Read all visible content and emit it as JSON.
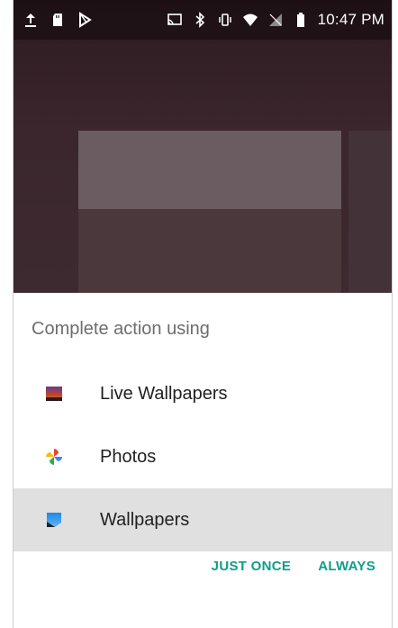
{
  "status_bar": {
    "time": "10:47 PM",
    "left_icons": [
      "upload-icon",
      "sd-card-icon",
      "play-store-icon"
    ],
    "right_icons": [
      "cast-icon",
      "bluetooth-icon",
      "vibrate-icon",
      "wifi-icon",
      "no-sim-icon",
      "battery-icon"
    ]
  },
  "dialog": {
    "title": "Complete action using",
    "options": [
      {
        "label": "Live Wallpapers",
        "icon": "live-wallpapers-icon",
        "selected": false
      },
      {
        "label": "Photos",
        "icon": "photos-icon",
        "selected": false
      },
      {
        "label": "Wallpapers",
        "icon": "wallpapers-icon",
        "selected": true
      }
    ],
    "buttons": {
      "just_once": "JUST ONCE",
      "always": "ALWAYS"
    }
  },
  "colors": {
    "accent": "#0f9d8a",
    "wallpaper": "#3a262c",
    "selected_row": "#e0e0e0"
  }
}
